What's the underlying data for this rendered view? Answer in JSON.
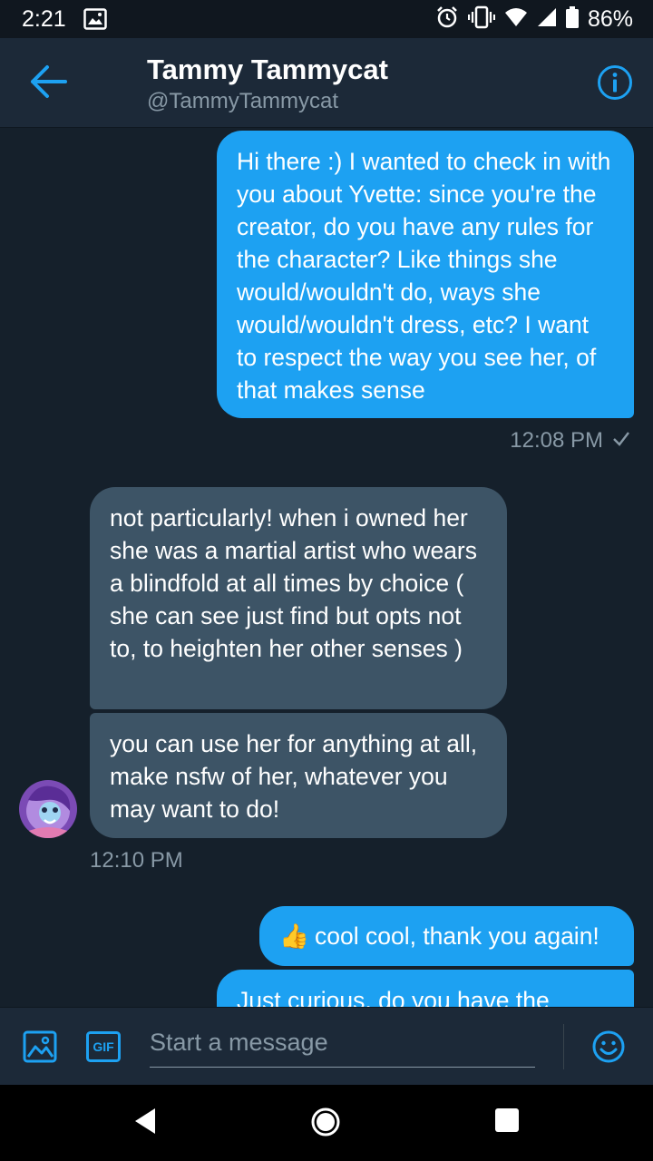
{
  "status_bar": {
    "time": "2:21",
    "battery": "86%"
  },
  "header": {
    "name": "Tammy Tammycat",
    "handle": "@TammyTammycat"
  },
  "messages": [
    {
      "direction": "out",
      "text": "Hi there :) I wanted to check in with you about Yvette: since you're the creator, do you have any rules for the character? Like things she would/wouldn't do, ways she would/wouldn't dress, etc? I want to respect the way you see her, of that makes sense"
    },
    {
      "direction": "in",
      "text": "not particularly! when i owned her she was a martial artist who wears a blindfold at all times by choice ( she can see just find but opts not to, to heighten her other senses )"
    },
    {
      "direction": "in",
      "text": "you can use her for anything at all, make nsfw of her, whatever you may want to do!"
    },
    {
      "direction": "out",
      "text": "cool cool, thank you again!",
      "emoji": "👍"
    },
    {
      "direction": "out",
      "text": "Just curious, do you have the"
    }
  ],
  "timestamps": {
    "first": "12:08 PM",
    "second": "12:10 PM"
  },
  "composer": {
    "placeholder": "Start a message",
    "gif_label": "GIF"
  },
  "colors": {
    "background": "#15202b",
    "header": "#1c2938",
    "accent": "#1da1f2",
    "incoming_bubble": "#3d5466",
    "muted_text": "#8899a6"
  },
  "icons": [
    "back-arrow-icon",
    "info-icon",
    "image-icon",
    "gif-icon",
    "emoji-icon",
    "alarm-icon",
    "vibrate-icon",
    "wifi-icon",
    "signal-icon",
    "battery-icon",
    "read-check-icon",
    "nav-back-icon",
    "nav-home-icon",
    "nav-recents-icon"
  ]
}
